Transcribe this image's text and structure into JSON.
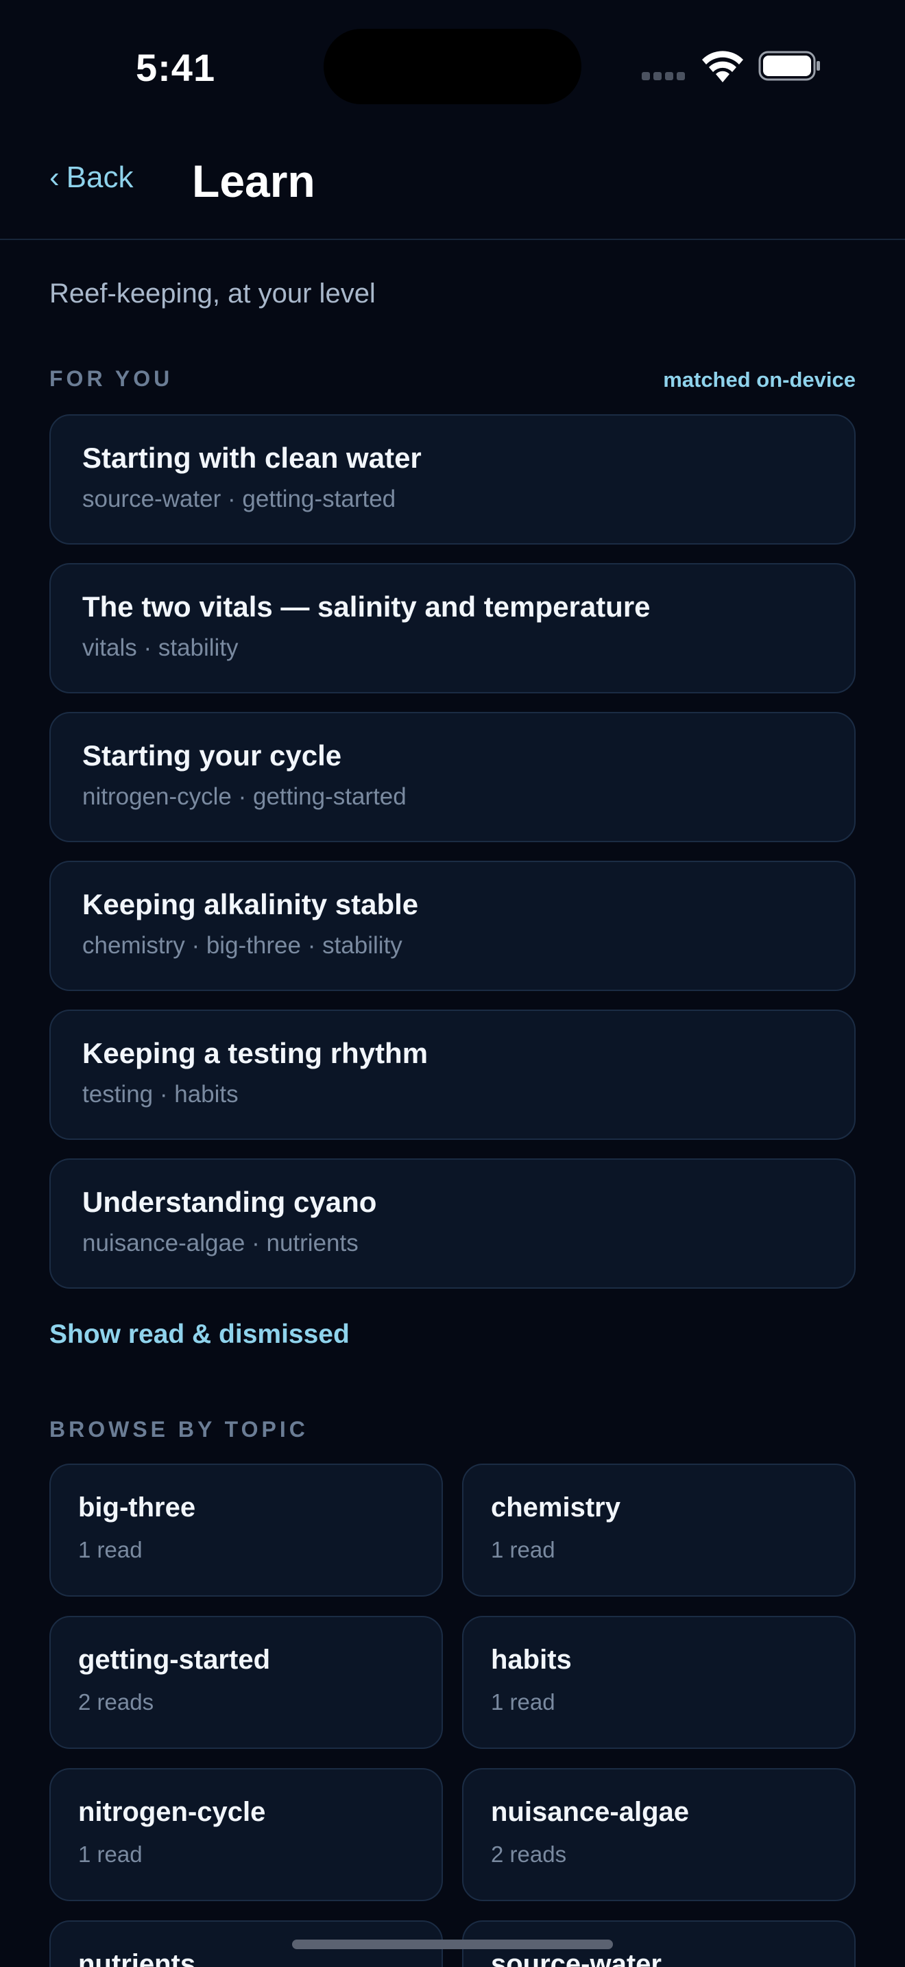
{
  "status_bar": {
    "time": "5:41"
  },
  "nav": {
    "back_label": "Back",
    "title": "Learn"
  },
  "subtitle": "Reef-keeping, at your level",
  "for_you": {
    "label": "FOR YOU",
    "note": "matched on-device",
    "articles": [
      {
        "title": "Starting with clean water",
        "tags": "source-water · getting-started"
      },
      {
        "title": "The two vitals — salinity and temperature",
        "tags": "vitals · stability"
      },
      {
        "title": "Starting your cycle",
        "tags": "nitrogen-cycle · getting-started"
      },
      {
        "title": "Keeping alkalinity stable",
        "tags": "chemistry · big-three · stability"
      },
      {
        "title": "Keeping a testing rhythm",
        "tags": "testing · habits"
      },
      {
        "title": "Understanding cyano",
        "tags": "nuisance-algae · nutrients"
      }
    ],
    "show_read_label": "Show read & dismissed"
  },
  "browse": {
    "label": "BROWSE BY TOPIC",
    "topics": [
      {
        "name": "big-three",
        "count": "1 read"
      },
      {
        "name": "chemistry",
        "count": "1 read"
      },
      {
        "name": "getting-started",
        "count": "2 reads"
      },
      {
        "name": "habits",
        "count": "1 read"
      },
      {
        "name": "nitrogen-cycle",
        "count": "1 read"
      },
      {
        "name": "nuisance-algae",
        "count": "2 reads"
      },
      {
        "name": "nutrients",
        "count": ""
      },
      {
        "name": "source-water",
        "count": ""
      }
    ]
  },
  "colors": {
    "background": "#050914",
    "card": "#0b1526",
    "accent": "#8fd3ec"
  },
  "icons": {
    "back": "chevron-left-icon",
    "wifi": "wifi-icon",
    "battery": "battery-icon",
    "signal": "signal-icon"
  }
}
